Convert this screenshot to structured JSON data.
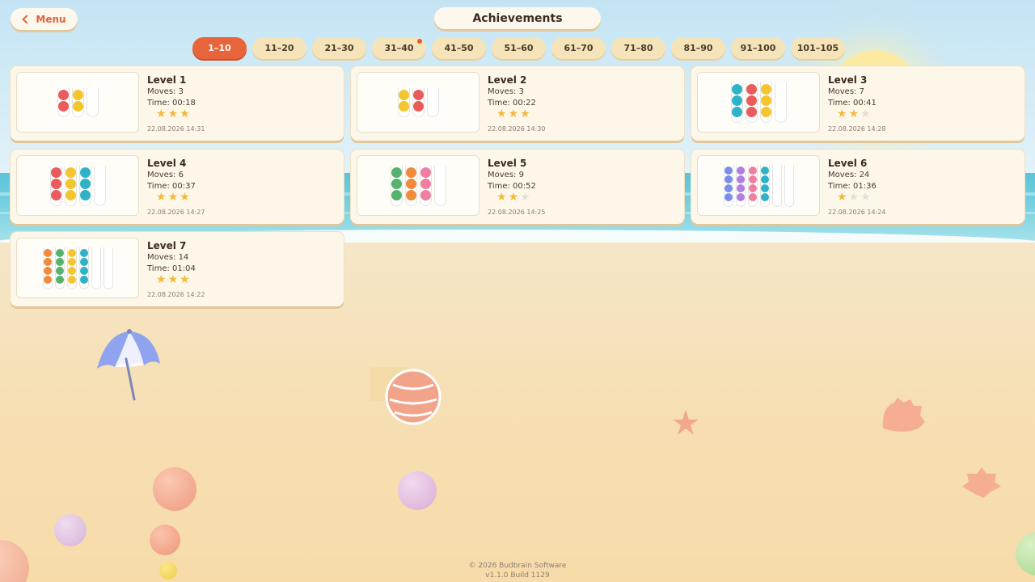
{
  "menu": {
    "label": "Menu",
    "icon": "chevron-left-icon"
  },
  "title": "Achievements",
  "tabs": [
    {
      "label": "1–10",
      "active": true,
      "notify": false
    },
    {
      "label": "11–20",
      "active": false,
      "notify": false
    },
    {
      "label": "21–30",
      "active": false,
      "notify": false
    },
    {
      "label": "31–40",
      "active": false,
      "notify": true
    },
    {
      "label": "41–50",
      "active": false,
      "notify": false
    },
    {
      "label": "51–60",
      "active": false,
      "notify": false
    },
    {
      "label": "61–70",
      "active": false,
      "notify": false
    },
    {
      "label": "71–80",
      "active": false,
      "notify": false
    },
    {
      "label": "81–90",
      "active": false,
      "notify": false
    },
    {
      "label": "91–100",
      "active": false,
      "notify": false
    },
    {
      "label": "101–105",
      "active": false,
      "notify": false
    }
  ],
  "levels": [
    {
      "title": "Level 1",
      "moves": "Moves: 3",
      "time": "Time: 00:18",
      "stars": 3,
      "date": "22.08.2026 14:31"
    },
    {
      "title": "Level 2",
      "moves": "Moves: 3",
      "time": "Time: 00:22",
      "stars": 3,
      "date": "22.08.2026 14:30"
    },
    {
      "title": "Level 3",
      "moves": "Moves: 7",
      "time": "Time: 00:41",
      "stars": 2,
      "date": "22.08.2026 14:28"
    },
    {
      "title": "Level 4",
      "moves": "Moves: 6",
      "time": "Time: 00:37",
      "stars": 3,
      "date": "22.08.2026 14:27"
    },
    {
      "title": "Level 5",
      "moves": "Moves: 9",
      "time": "Time: 00:52",
      "stars": 2,
      "date": "22.08.2026 14:25"
    },
    {
      "title": "Level 6",
      "moves": "Moves: 24",
      "time": "Time: 01:36",
      "stars": 1,
      "date": "22.08.2026 14:24"
    },
    {
      "title": "Level 7",
      "moves": "Moves: 14",
      "time": "Time: 01:04",
      "stars": 3,
      "date": "22.08.2026 14:22"
    }
  ],
  "thumbnails": [
    [
      [
        "red",
        "red"
      ],
      [
        "yellow",
        "yellow"
      ],
      []
    ],
    [
      [
        "yellow",
        "yellow"
      ],
      [
        "red",
        "red"
      ],
      []
    ],
    [
      [
        "teal",
        "teal",
        "teal"
      ],
      [
        "red",
        "red",
        "red"
      ],
      [
        "yellow",
        "yellow",
        "yellow"
      ],
      []
    ],
    [
      [
        "red",
        "red",
        "red"
      ],
      [
        "yellow",
        "yellow",
        "yellow"
      ],
      [
        "teal",
        "teal",
        "teal"
      ],
      []
    ],
    [
      [
        "green",
        "green",
        "green"
      ],
      [
        "orange",
        "orange",
        "orange"
      ],
      [
        "pink",
        "pink",
        "pink"
      ],
      []
    ],
    [
      [
        "blue",
        "blue",
        "blue",
        "blue"
      ],
      [
        "purple",
        "purple",
        "purple",
        "purple"
      ],
      [
        "pink",
        "pink",
        "pink",
        "pink"
      ],
      [
        "teal",
        "teal",
        "teal",
        "teal"
      ],
      [],
      []
    ],
    [
      [
        "orange",
        "orange",
        "orange",
        "orange"
      ],
      [
        "green",
        "green",
        "green",
        "green"
      ],
      [
        "yellow",
        "yellow",
        "yellow",
        "yellow"
      ],
      [
        "teal",
        "teal",
        "teal",
        "teal"
      ],
      [],
      []
    ]
  ],
  "ball_colors": {
    "red": "#ea5b5b",
    "yellow": "#f3c52f",
    "teal": "#2fb2c7",
    "green": "#56b26c",
    "orange": "#f08a3c",
    "pink": "#ef7fa0",
    "blue": "#7b8ee8",
    "purple": "#b07fe0"
  },
  "colors": {
    "accent": "#e8643b",
    "star": "#f3b93a"
  },
  "footer": {
    "copyright": "© 2026 Budbrain Software",
    "version": "v1.1.0 Build 1129"
  }
}
